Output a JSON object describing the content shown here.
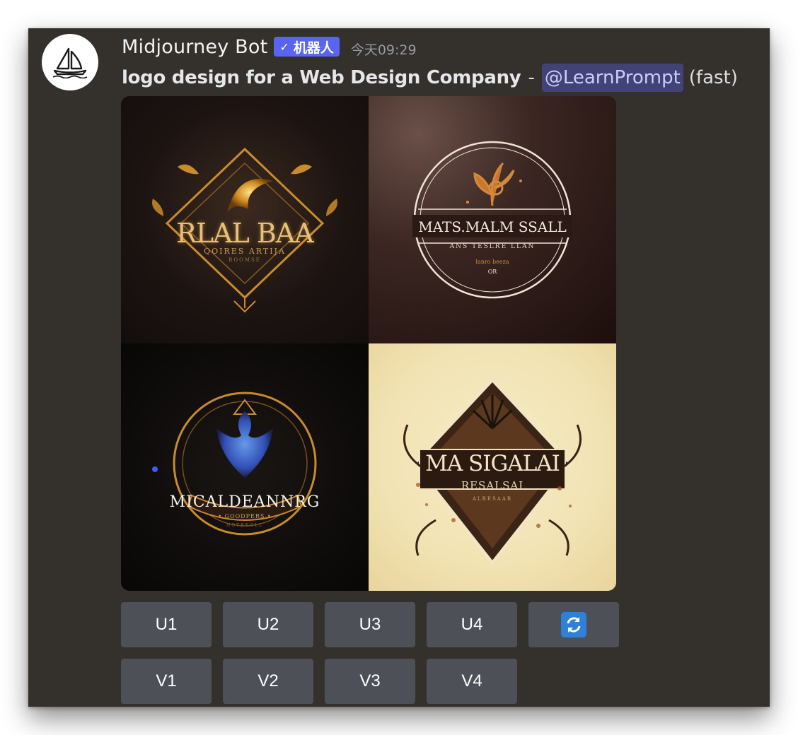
{
  "message": {
    "username": "Midjourney Bot",
    "bot_tag": {
      "check": "✓",
      "label": "机器人"
    },
    "timestamp": "今天09:29",
    "prompt_text": "logo design for a Web Design Company",
    "separator": "-",
    "mention": "@LearnPrompt",
    "mode": "(fast)"
  },
  "images": [
    {
      "logo_title": "RLAL BAA",
      "logo_subtitle": "QOIRES  ARTIJA",
      "logo_small": "ROOMSE"
    },
    {
      "logo_title": "MATS.MALM SSALL",
      "logo_subtitle": "ANS TESLRE  LLAN",
      "logo_small": "lanro  beeza",
      "logo_mark": "OR"
    },
    {
      "logo_title": "MICALDEANNRG",
      "logo_subtitle": "• GOODPERS •",
      "logo_small": "NOTREOLL"
    },
    {
      "logo_title": "MA SIGALAI",
      "logo_subtitle": "RESALSAI",
      "logo_small": "ALRESAAR"
    }
  ],
  "buttons": {
    "upscale": [
      "U1",
      "U2",
      "U3",
      "U4"
    ],
    "variation": [
      "V1",
      "V2",
      "V3",
      "V4"
    ],
    "reroll_icon": "refresh-icon"
  },
  "colors": {
    "background": "#34302b",
    "bot_tag": "#5865f2",
    "button": "#4e5058",
    "mention_bg": "#4b4f8f",
    "refresh_icon": "#2f80d8"
  }
}
